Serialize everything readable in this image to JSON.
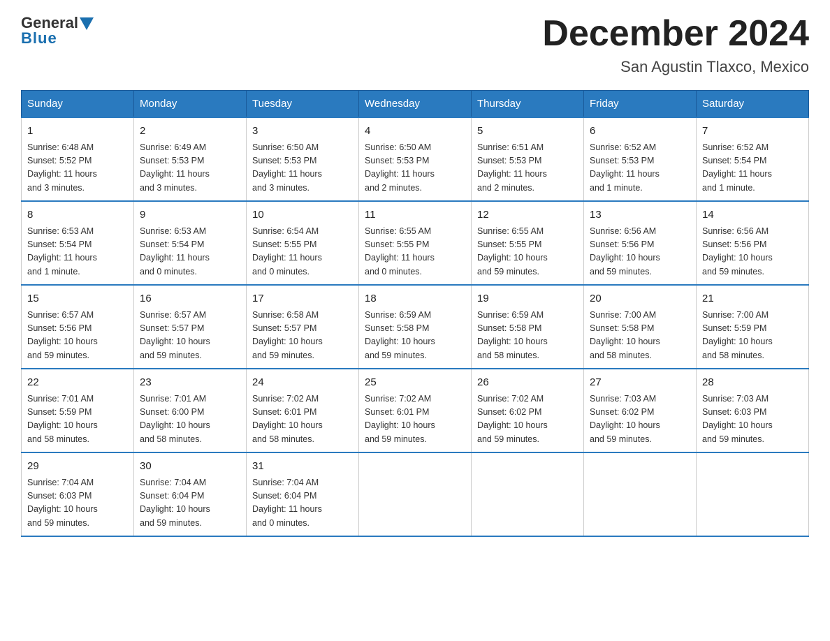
{
  "header": {
    "logo_general": "General",
    "logo_blue": "Blue",
    "month_title": "December 2024",
    "subtitle": "San Agustin Tlaxco, Mexico"
  },
  "weekdays": [
    "Sunday",
    "Monday",
    "Tuesday",
    "Wednesday",
    "Thursday",
    "Friday",
    "Saturday"
  ],
  "weeks": [
    [
      {
        "day": "1",
        "info": "Sunrise: 6:48 AM\nSunset: 5:52 PM\nDaylight: 11 hours\nand 3 minutes."
      },
      {
        "day": "2",
        "info": "Sunrise: 6:49 AM\nSunset: 5:53 PM\nDaylight: 11 hours\nand 3 minutes."
      },
      {
        "day": "3",
        "info": "Sunrise: 6:50 AM\nSunset: 5:53 PM\nDaylight: 11 hours\nand 3 minutes."
      },
      {
        "day": "4",
        "info": "Sunrise: 6:50 AM\nSunset: 5:53 PM\nDaylight: 11 hours\nand 2 minutes."
      },
      {
        "day": "5",
        "info": "Sunrise: 6:51 AM\nSunset: 5:53 PM\nDaylight: 11 hours\nand 2 minutes."
      },
      {
        "day": "6",
        "info": "Sunrise: 6:52 AM\nSunset: 5:53 PM\nDaylight: 11 hours\nand 1 minute."
      },
      {
        "day": "7",
        "info": "Sunrise: 6:52 AM\nSunset: 5:54 PM\nDaylight: 11 hours\nand 1 minute."
      }
    ],
    [
      {
        "day": "8",
        "info": "Sunrise: 6:53 AM\nSunset: 5:54 PM\nDaylight: 11 hours\nand 1 minute."
      },
      {
        "day": "9",
        "info": "Sunrise: 6:53 AM\nSunset: 5:54 PM\nDaylight: 11 hours\nand 0 minutes."
      },
      {
        "day": "10",
        "info": "Sunrise: 6:54 AM\nSunset: 5:55 PM\nDaylight: 11 hours\nand 0 minutes."
      },
      {
        "day": "11",
        "info": "Sunrise: 6:55 AM\nSunset: 5:55 PM\nDaylight: 11 hours\nand 0 minutes."
      },
      {
        "day": "12",
        "info": "Sunrise: 6:55 AM\nSunset: 5:55 PM\nDaylight: 10 hours\nand 59 minutes."
      },
      {
        "day": "13",
        "info": "Sunrise: 6:56 AM\nSunset: 5:56 PM\nDaylight: 10 hours\nand 59 minutes."
      },
      {
        "day": "14",
        "info": "Sunrise: 6:56 AM\nSunset: 5:56 PM\nDaylight: 10 hours\nand 59 minutes."
      }
    ],
    [
      {
        "day": "15",
        "info": "Sunrise: 6:57 AM\nSunset: 5:56 PM\nDaylight: 10 hours\nand 59 minutes."
      },
      {
        "day": "16",
        "info": "Sunrise: 6:57 AM\nSunset: 5:57 PM\nDaylight: 10 hours\nand 59 minutes."
      },
      {
        "day": "17",
        "info": "Sunrise: 6:58 AM\nSunset: 5:57 PM\nDaylight: 10 hours\nand 59 minutes."
      },
      {
        "day": "18",
        "info": "Sunrise: 6:59 AM\nSunset: 5:58 PM\nDaylight: 10 hours\nand 59 minutes."
      },
      {
        "day": "19",
        "info": "Sunrise: 6:59 AM\nSunset: 5:58 PM\nDaylight: 10 hours\nand 58 minutes."
      },
      {
        "day": "20",
        "info": "Sunrise: 7:00 AM\nSunset: 5:58 PM\nDaylight: 10 hours\nand 58 minutes."
      },
      {
        "day": "21",
        "info": "Sunrise: 7:00 AM\nSunset: 5:59 PM\nDaylight: 10 hours\nand 58 minutes."
      }
    ],
    [
      {
        "day": "22",
        "info": "Sunrise: 7:01 AM\nSunset: 5:59 PM\nDaylight: 10 hours\nand 58 minutes."
      },
      {
        "day": "23",
        "info": "Sunrise: 7:01 AM\nSunset: 6:00 PM\nDaylight: 10 hours\nand 58 minutes."
      },
      {
        "day": "24",
        "info": "Sunrise: 7:02 AM\nSunset: 6:01 PM\nDaylight: 10 hours\nand 58 minutes."
      },
      {
        "day": "25",
        "info": "Sunrise: 7:02 AM\nSunset: 6:01 PM\nDaylight: 10 hours\nand 59 minutes."
      },
      {
        "day": "26",
        "info": "Sunrise: 7:02 AM\nSunset: 6:02 PM\nDaylight: 10 hours\nand 59 minutes."
      },
      {
        "day": "27",
        "info": "Sunrise: 7:03 AM\nSunset: 6:02 PM\nDaylight: 10 hours\nand 59 minutes."
      },
      {
        "day": "28",
        "info": "Sunrise: 7:03 AM\nSunset: 6:03 PM\nDaylight: 10 hours\nand 59 minutes."
      }
    ],
    [
      {
        "day": "29",
        "info": "Sunrise: 7:04 AM\nSunset: 6:03 PM\nDaylight: 10 hours\nand 59 minutes."
      },
      {
        "day": "30",
        "info": "Sunrise: 7:04 AM\nSunset: 6:04 PM\nDaylight: 10 hours\nand 59 minutes."
      },
      {
        "day": "31",
        "info": "Sunrise: 7:04 AM\nSunset: 6:04 PM\nDaylight: 11 hours\nand 0 minutes."
      },
      {
        "day": "",
        "info": ""
      },
      {
        "day": "",
        "info": ""
      },
      {
        "day": "",
        "info": ""
      },
      {
        "day": "",
        "info": ""
      }
    ]
  ]
}
